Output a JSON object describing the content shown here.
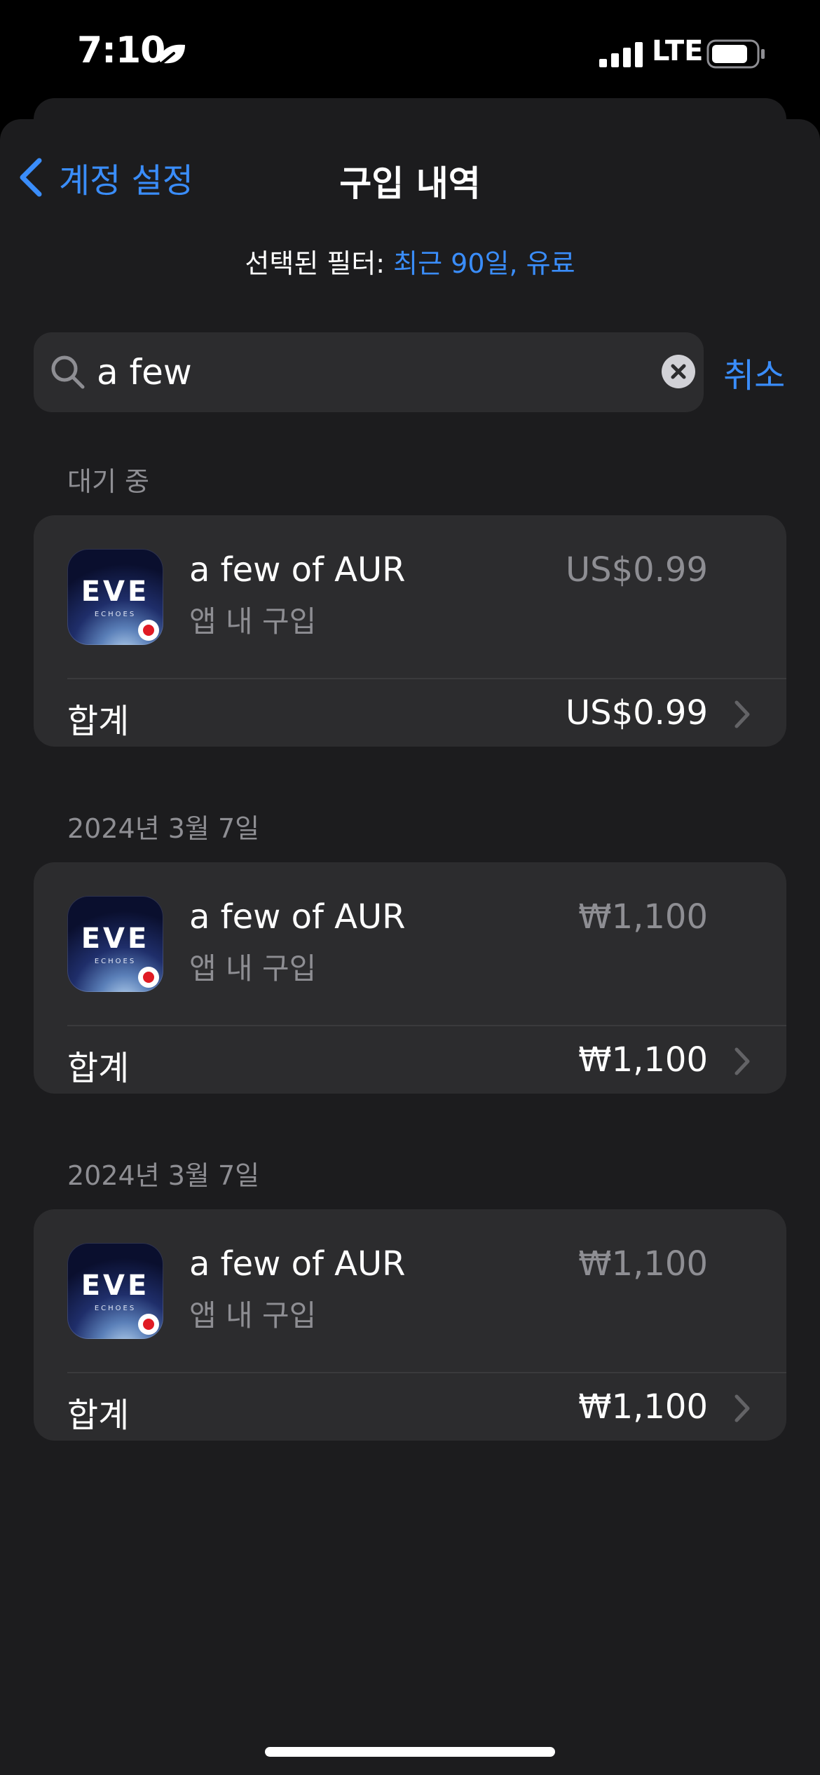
{
  "status_bar": {
    "time": "7:10",
    "network": "LTE"
  },
  "nav": {
    "back_label": "계정 설정",
    "title": "구입 내역"
  },
  "filter": {
    "prefix": "선택된 필터: ",
    "value": "최근 90일, 유료"
  },
  "search": {
    "query": "a few",
    "cancel_label": "취소"
  },
  "sections": [
    {
      "header": "대기 중",
      "item": {
        "name": "a few of AUR",
        "type": "앱 내 구입",
        "price": "US$0.99",
        "icon": "eve-echoes-app-icon"
      },
      "total_label": "합계",
      "total_amount": "US$0.99"
    },
    {
      "header": "2024년 3월 7일",
      "item": {
        "name": "a few of AUR",
        "type": "앱 내 구입",
        "price": "₩1,100",
        "icon": "eve-echoes-app-icon"
      },
      "total_label": "합계",
      "total_amount": "₩1,100"
    },
    {
      "header": "2024년 3월 7일",
      "item": {
        "name": "a few of AUR",
        "type": "앱 내 구입",
        "price": "₩1,100",
        "icon": "eve-echoes-app-icon"
      },
      "total_label": "합계",
      "total_amount": "₩1,100"
    }
  ],
  "app_icon_text": {
    "logo": "EVE",
    "sub": "ECHOES"
  },
  "colors": {
    "accent": "#3a8dfb",
    "background": "#1c1c1e",
    "card": "#2c2c2e",
    "secondary_text": "#8e8e93"
  }
}
